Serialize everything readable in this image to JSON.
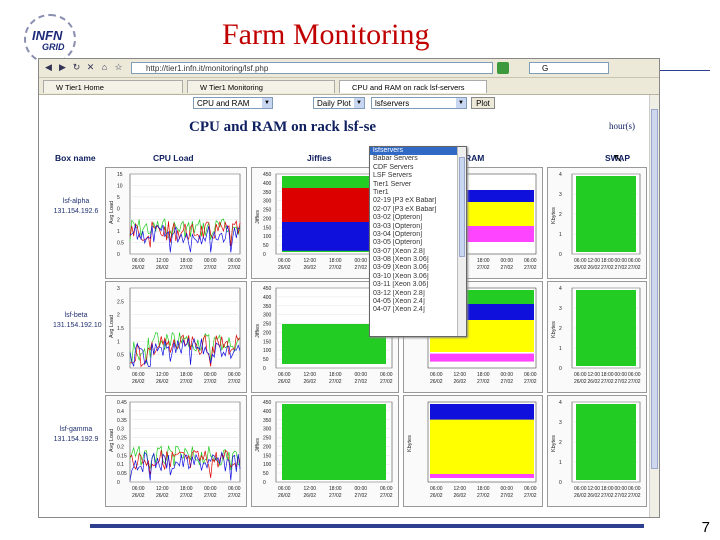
{
  "slide": {
    "title": "Farm Monitoring",
    "page_number": "7",
    "logo": {
      "top": "INFN",
      "bottom": "GRID"
    }
  },
  "browser": {
    "address": "http://tier1.infn.it/monitoring/lsf.php",
    "search_placeholder": "G",
    "tabs": [
      {
        "label": "W  Tier1 Home"
      },
      {
        "label": "W  Tier1 Monitoring"
      },
      {
        "label": "CPU and RAM on rack lsf-servers"
      }
    ]
  },
  "controls": {
    "metric": "CPU and RAM",
    "period": "Daily Plot",
    "group": "lsfservers",
    "plot_button": "Plot"
  },
  "dropdown": {
    "items": [
      "lsfservers",
      "Babar Servers",
      "CDF Servers",
      "LSF Servers",
      "Tier1 Server",
      "Tier1",
      "02-19 [P3 eX Babar]",
      "02-07 [P3 eX Babar]",
      "03-02 [Opteron]",
      "03-03 [Opteron]",
      "03-04 [Opteron]",
      "03-05 [Opteron]",
      "03-07 [Xeon 2.8]",
      "03-08 [Xeon 3.06]",
      "03-09 [Xeon 3.06]",
      "03-10 [Xeon 3.06]",
      "03-11 [Xeon 3.06]",
      "03-12 [Xeon 2.8]",
      "04-05 [Xeon 2.4]",
      "04-07 [Xeon 2.4]"
    ],
    "selected_index": 0
  },
  "page": {
    "heading": "CPU and RAM on rack lsf-se",
    "heading_tail": "hour(s)",
    "columns": [
      "Box name",
      "CPU Load",
      "Jiffies",
      "RAM",
      "SWAP"
    ]
  },
  "rows": [
    {
      "host": "lsf-alpha",
      "ip": "131.154.192.6",
      "cpu_axis": "Avg Load",
      "cpu_ticks": [
        "15",
        "10",
        "5",
        "0",
        "2",
        "1",
        "0.5",
        "0"
      ],
      "jiffies_axis": "Jiffies",
      "jiffies_ticks": [
        "450",
        "400",
        "350",
        "300",
        "250",
        "200",
        "150",
        "100",
        "50",
        "0"
      ],
      "swap_axis": "Kbytes",
      "swap_ticks": [
        "4",
        "3",
        "2",
        "1",
        "0"
      ]
    },
    {
      "host": "lsf-beta",
      "ip": "131.154.192.10",
      "cpu_axis": "Avg Load",
      "cpu_ticks": [
        "3",
        "2.5",
        "2",
        "1.5",
        "1",
        "0.5",
        "0"
      ],
      "jiffies_axis": "Jiffies",
      "jiffies_ticks": [
        "450",
        "400",
        "350",
        "300",
        "250",
        "200",
        "150",
        "100",
        "50",
        "0"
      ],
      "swap_axis": "Kbytes",
      "swap_ticks": [
        "4",
        "3",
        "2",
        "1",
        "0"
      ]
    },
    {
      "host": "lsf-gamma",
      "ip": "131.154.192.9",
      "cpu_axis": "Avg Load",
      "cpu_ticks": [
        "0.45",
        "0.4",
        "0.35",
        "0.3",
        "0.25",
        "0.2",
        "0.15",
        "0.1",
        "0.05",
        "0"
      ],
      "jiffies_axis": "Jiffies",
      "jiffies_ticks": [
        "450",
        "400",
        "350",
        "300",
        "250",
        "200",
        "150",
        "100",
        "50",
        "0"
      ],
      "ram_axis": "Kbytes",
      "swap_axis": "Kbytes",
      "swap_ticks": [
        "4",
        "3",
        "2",
        "1",
        "0"
      ]
    }
  ],
  "time_ticks": [
    "06:00\n26/02",
    "12:00\n26/02",
    "18:00\n27/02",
    "00:00\n27/02",
    "06:00\n27/02"
  ],
  "colors": {
    "title": "#c00000",
    "heading": "#102060",
    "green": "#22cc22",
    "red": "#dd0000",
    "blue": "#1010dd",
    "yellow": "#ffff00",
    "magenta": "#ff44ff",
    "navy": "#2f3f8f"
  }
}
